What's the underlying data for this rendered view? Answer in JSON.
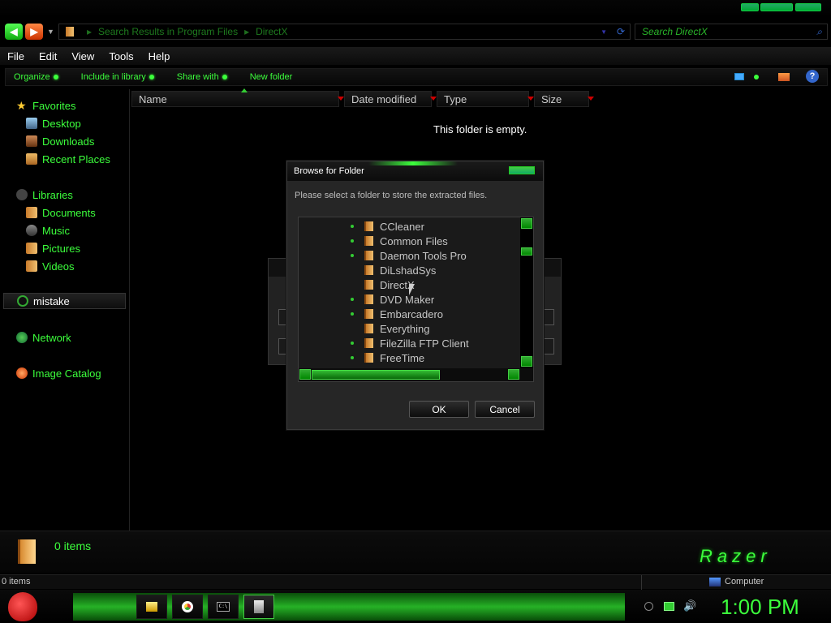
{
  "address": {
    "segments": [
      "Search Results in Program Files",
      "DirectX"
    ]
  },
  "search": {
    "placeholder": "Search DirectX"
  },
  "menu": {
    "items": [
      "File",
      "Edit",
      "View",
      "Tools",
      "Help"
    ]
  },
  "commands": {
    "items": [
      "Organize",
      "Include in library",
      "Share with",
      "New folder"
    ]
  },
  "nav": {
    "favorites": "Favorites",
    "favorite_items": [
      "Desktop",
      "Downloads",
      "Recent Places"
    ],
    "libraries": "Libraries",
    "library_items": [
      "Documents",
      "Music",
      "Pictures",
      "Videos"
    ],
    "homegroup": "mistake",
    "network": "Network",
    "image_catalog": "Image Catalog"
  },
  "columns": [
    "Name",
    "Date modified",
    "Type",
    "Size"
  ],
  "content": {
    "empty_message": "This folder is empty."
  },
  "dialog": {
    "title": "Browse for Folder",
    "message": "Please select a folder to store the extracted files.",
    "folders": [
      {
        "name": "CCleaner",
        "expandable": true
      },
      {
        "name": "Common Files",
        "expandable": true
      },
      {
        "name": "Daemon Tools Pro",
        "expandable": true
      },
      {
        "name": "DiLshadSys",
        "expandable": false
      },
      {
        "name": "DirectX",
        "expandable": false
      },
      {
        "name": "DVD Maker",
        "expandable": true
      },
      {
        "name": "Embarcadero",
        "expandable": true
      },
      {
        "name": "Everything",
        "expandable": false
      },
      {
        "name": "FileZilla FTP Client",
        "expandable": true
      },
      {
        "name": "FreeTime",
        "expandable": true
      }
    ],
    "ok_label": "OK",
    "cancel_label": "Cancel"
  },
  "details": {
    "count": "0 items",
    "brand": "Razer"
  },
  "statusbar": {
    "left": "0 items",
    "right": "Computer"
  },
  "taskbar": {
    "clock": "1:00 PM"
  },
  "colors": {
    "accent": "#3cff3c",
    "background": "#000000"
  }
}
